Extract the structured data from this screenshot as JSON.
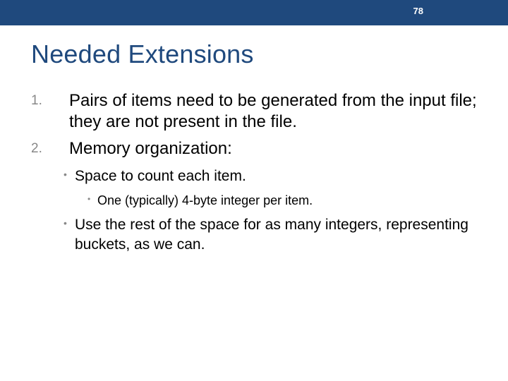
{
  "slide": {
    "page_number": "78",
    "title": "Needed Extensions",
    "numbered": [
      {
        "text": "Pairs of items need to be generated from the input file; they are not present in the file."
      },
      {
        "text": "Memory organization:"
      }
    ],
    "bullets": [
      {
        "text": "Space to count each item.",
        "sub": [
          {
            "text": "One (typically) 4-byte integer per item."
          }
        ]
      },
      {
        "text": "Use the rest of the space for as many integers, representing buckets, as we can."
      }
    ]
  }
}
